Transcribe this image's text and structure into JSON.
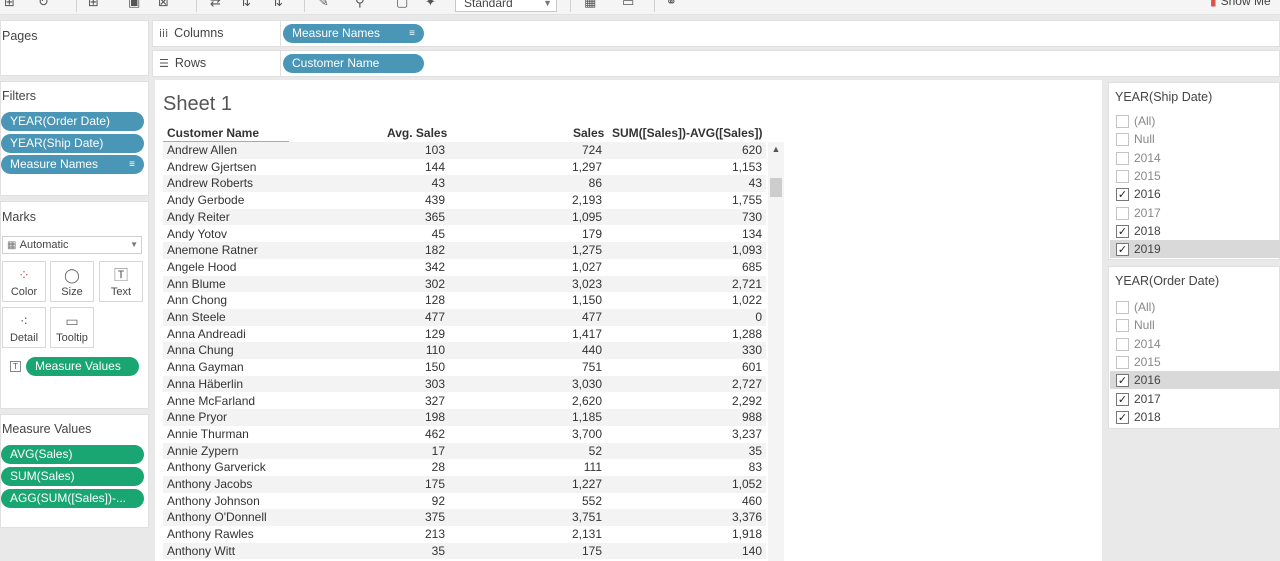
{
  "toolbar": {
    "standard_label": "Standard",
    "show_me_label": "Show Me"
  },
  "pages": {
    "title": "Pages"
  },
  "shelves": {
    "columns_label": "Columns",
    "columns_pill": "Measure Names",
    "rows_label": "Rows",
    "rows_pill": "Customer Name"
  },
  "filters": {
    "title": "Filters",
    "pills": [
      "YEAR(Order Date)",
      "YEAR(Ship Date)",
      "Measure Names"
    ]
  },
  "marks": {
    "title": "Marks",
    "type": "Automatic",
    "buttons": [
      "Color",
      "Size",
      "Text",
      "Detail",
      "Tooltip"
    ],
    "measure_values_pill": "Measure Values"
  },
  "measure_values": {
    "title": "Measure Values",
    "pills": [
      "AVG(Sales)",
      "SUM(Sales)",
      "AGG(SUM([Sales])-..."
    ]
  },
  "sheet": {
    "title": "Sheet 1",
    "headers": {
      "name": "Customer Name",
      "avg": "Avg. Sales",
      "sum": "Sales",
      "diff": "SUM([Sales])-AVG([Sales])"
    },
    "rows": [
      {
        "name": "Andrew Allen",
        "avg": "103",
        "sum": "724",
        "diff": "620"
      },
      {
        "name": "Andrew Gjertsen",
        "avg": "144",
        "sum": "1,297",
        "diff": "1,153"
      },
      {
        "name": "Andrew Roberts",
        "avg": "43",
        "sum": "86",
        "diff": "43"
      },
      {
        "name": "Andy Gerbode",
        "avg": "439",
        "sum": "2,193",
        "diff": "1,755"
      },
      {
        "name": "Andy Reiter",
        "avg": "365",
        "sum": "1,095",
        "diff": "730"
      },
      {
        "name": "Andy Yotov",
        "avg": "45",
        "sum": "179",
        "diff": "134"
      },
      {
        "name": "Anemone Ratner",
        "avg": "182",
        "sum": "1,275",
        "diff": "1,093"
      },
      {
        "name": "Angele Hood",
        "avg": "342",
        "sum": "1,027",
        "diff": "685"
      },
      {
        "name": "Ann Blume",
        "avg": "302",
        "sum": "3,023",
        "diff": "2,721"
      },
      {
        "name": "Ann Chong",
        "avg": "128",
        "sum": "1,150",
        "diff": "1,022"
      },
      {
        "name": "Ann Steele",
        "avg": "477",
        "sum": "477",
        "diff": "0"
      },
      {
        "name": "Anna Andreadi",
        "avg": "129",
        "sum": "1,417",
        "diff": "1,288"
      },
      {
        "name": "Anna Chung",
        "avg": "110",
        "sum": "440",
        "diff": "330"
      },
      {
        "name": "Anna Gayman",
        "avg": "150",
        "sum": "751",
        "diff": "601"
      },
      {
        "name": "Anna Häberlin",
        "avg": "303",
        "sum": "3,030",
        "diff": "2,727"
      },
      {
        "name": "Anne McFarland",
        "avg": "327",
        "sum": "2,620",
        "diff": "2,292"
      },
      {
        "name": "Anne Pryor",
        "avg": "198",
        "sum": "1,185",
        "diff": "988"
      },
      {
        "name": "Annie Thurman",
        "avg": "462",
        "sum": "3,700",
        "diff": "3,237"
      },
      {
        "name": "Annie Zypern",
        "avg": "17",
        "sum": "52",
        "diff": "35"
      },
      {
        "name": "Anthony Garverick",
        "avg": "28",
        "sum": "111",
        "diff": "83"
      },
      {
        "name": "Anthony Jacobs",
        "avg": "175",
        "sum": "1,227",
        "diff": "1,052"
      },
      {
        "name": "Anthony Johnson",
        "avg": "92",
        "sum": "552",
        "diff": "460"
      },
      {
        "name": "Anthony O'Donnell",
        "avg": "375",
        "sum": "3,751",
        "diff": "3,376"
      },
      {
        "name": "Anthony Rawles",
        "avg": "213",
        "sum": "2,131",
        "diff": "1,918"
      },
      {
        "name": "Anthony Witt",
        "avg": "35",
        "sum": "175",
        "diff": "140"
      }
    ]
  },
  "ship_filter": {
    "title": "YEAR(Ship Date)",
    "options": [
      {
        "label": "(All)",
        "checked": false
      },
      {
        "label": "Null",
        "checked": false
      },
      {
        "label": "2014",
        "checked": false
      },
      {
        "label": "2015",
        "checked": false
      },
      {
        "label": "2016",
        "checked": true
      },
      {
        "label": "2017",
        "checked": false
      },
      {
        "label": "2018",
        "checked": true
      },
      {
        "label": "2019",
        "checked": true
      }
    ]
  },
  "order_filter": {
    "title": "YEAR(Order Date)",
    "options": [
      {
        "label": "(All)",
        "checked": false
      },
      {
        "label": "Null",
        "checked": false
      },
      {
        "label": "2014",
        "checked": false
      },
      {
        "label": "2015",
        "checked": false
      },
      {
        "label": "2016",
        "checked": true
      },
      {
        "label": "2017",
        "checked": true
      },
      {
        "label": "2018",
        "checked": true
      }
    ]
  }
}
